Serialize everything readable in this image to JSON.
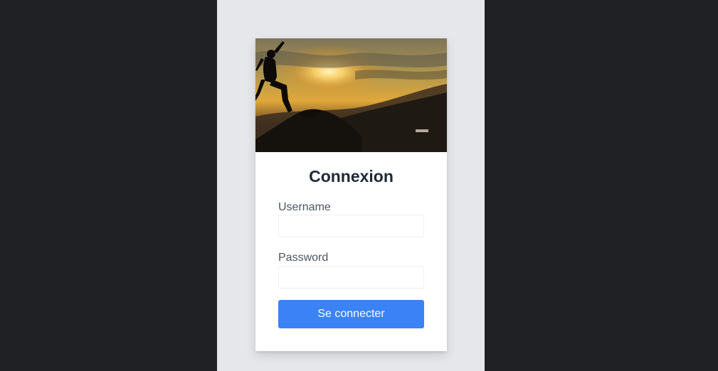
{
  "login": {
    "title": "Connexion",
    "username_label": "Username",
    "username_value": "",
    "password_label": "Password",
    "password_value": "",
    "submit_label": "Se connecter"
  },
  "colors": {
    "page_background": "#202124",
    "viewport_background": "#e5e7eb",
    "card_background": "#ffffff",
    "title_color": "#1f2937",
    "label_color": "#4b5563",
    "button_color": "#3b82f6",
    "button_text": "#ffffff"
  },
  "hero_image": {
    "subject": "silhouette of a person jumping over rocks at sunset"
  }
}
